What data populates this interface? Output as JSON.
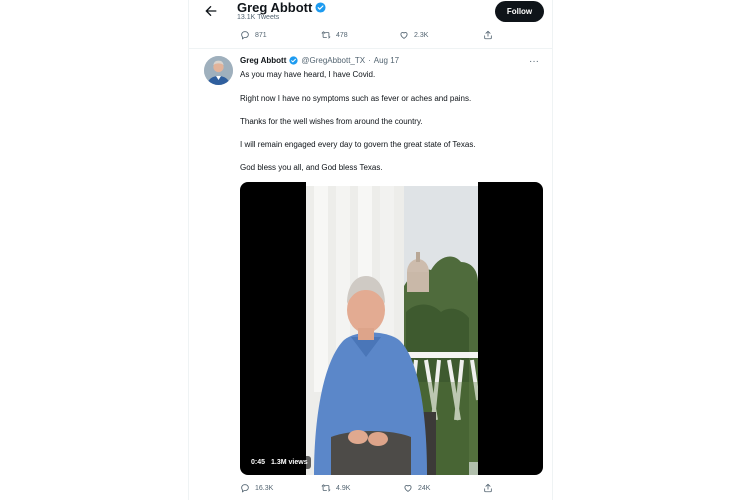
{
  "header": {
    "name": "Greg Abbott",
    "tweet_count": "13.1K Tweets",
    "follow_label": "Follow"
  },
  "prev_tweet_actions": {
    "replies": "871",
    "retweets": "478",
    "likes": "2.3K"
  },
  "tweet": {
    "display_name": "Greg Abbott",
    "handle": "@GregAbbott_TX",
    "separator": "·",
    "date": "Aug 17",
    "more_label": "···",
    "lines": [
      "As you may have heard, I have Covid.",
      "Right now I have no symptoms such as fever or aches and pains.",
      "Thanks for the well wishes from around the country.",
      "I will remain engaged every day to govern the great state of Texas.",
      "God bless you all, and God bless Texas."
    ],
    "video": {
      "duration": "0:45",
      "views": "1.3M views"
    },
    "actions": {
      "replies": "16.3K",
      "retweets": "4.9K",
      "likes": "24K"
    }
  },
  "icons": {
    "back": "arrow-left-icon",
    "verified": "verified-badge-icon",
    "reply": "reply-icon",
    "retweet": "retweet-icon",
    "like": "heart-icon",
    "share": "share-icon"
  },
  "colors": {
    "verified_blue": "#1d9bf0",
    "follow_bg": "#0f1419",
    "secondary_text": "#536471"
  }
}
